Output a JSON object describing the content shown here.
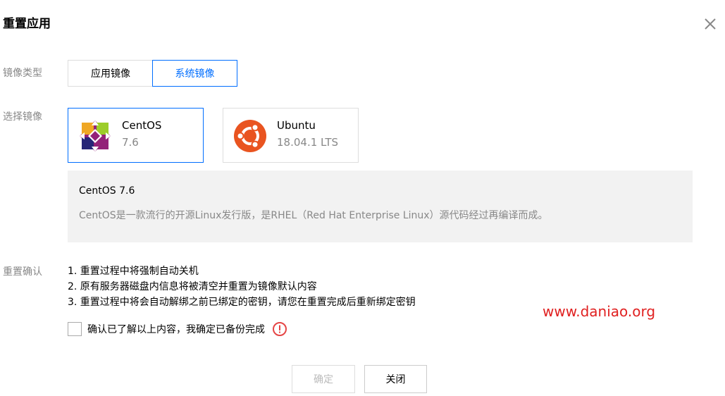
{
  "dialog": {
    "title": "重置应用",
    "close_icon": "close-icon"
  },
  "image_type": {
    "label": "镜像类型",
    "options": [
      "应用镜像",
      "系统镜像"
    ],
    "selected": "系统镜像"
  },
  "select_image": {
    "label": "选择镜像",
    "cards": [
      {
        "name": "CentOS",
        "version": "7.6",
        "icon": "centos-logo-icon",
        "selected": true
      },
      {
        "name": "Ubuntu",
        "version": "18.04.1 LTS",
        "icon": "ubuntu-logo-icon",
        "selected": false
      }
    ]
  },
  "info": {
    "title": "CentOS 7.6",
    "description": "CentOS是一款流行的开源Linux发行版，是RHEL（Red Hat Enterprise Linux）源代码经过再编译而成。"
  },
  "confirm": {
    "label": "重置确认",
    "notes": [
      "1. 重置过程中将强制自动关机",
      "2. 原有服务器磁盘内信息将被清空并重置为镜像默认内容",
      "3. 重置过程中将会自动解绑之前已绑定的密钥，请您在重置完成后重新绑定密钥"
    ],
    "checkbox_label": "确认已了解以上内容，我确定已备份完成",
    "checked": false,
    "warning_icon": "warning-icon"
  },
  "watermark": "www.daniao.org",
  "buttons": {
    "ok": "确定",
    "close": "关闭"
  },
  "colors": {
    "accent": "#006eff",
    "warning": "#e54545",
    "ubuntu": "#e95420",
    "watermark": "#e02020"
  }
}
